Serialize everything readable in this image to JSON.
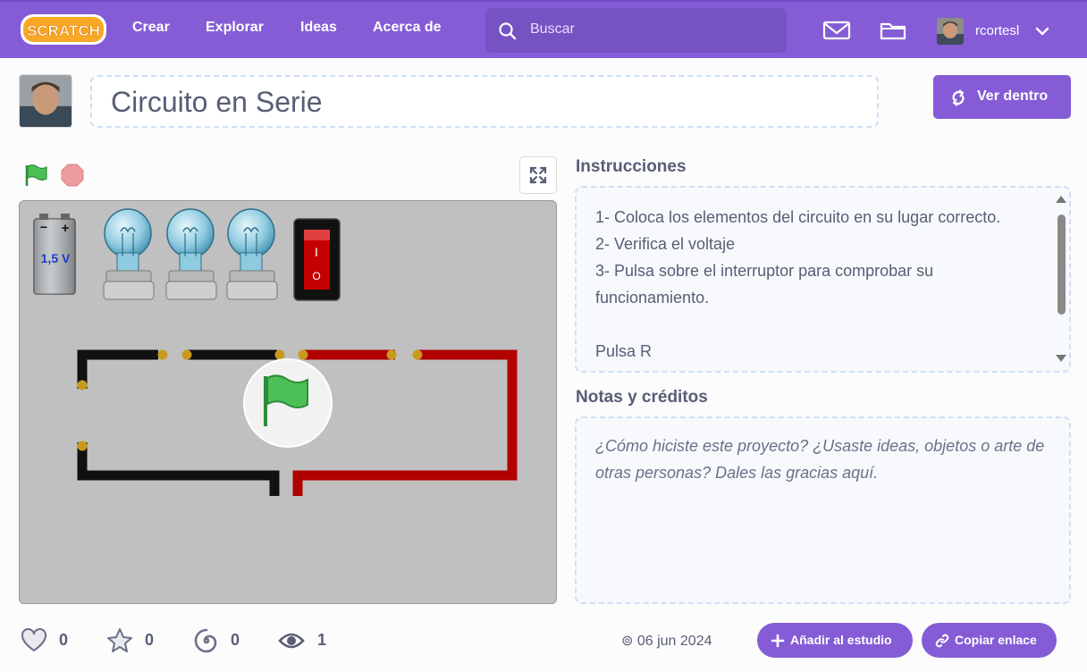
{
  "nav": {
    "logo_text": "SCRATCH",
    "links": [
      "Crear",
      "Explorar",
      "Ideas",
      "Acerca de"
    ],
    "search_placeholder": "Buscar",
    "username": "rcortesl"
  },
  "project": {
    "title": "Circuito en Serie",
    "see_inside_label": "Ver dentro"
  },
  "stage": {
    "battery_label": "1,5 V",
    "battery_minus": "−",
    "battery_plus": "+",
    "switch_on": "I",
    "switch_off": "O"
  },
  "instructions": {
    "heading": "Instrucciones",
    "text": "1- Coloca los elementos del circuito en su lugar correcto.\n2- Verifica el voltaje\n3- Pulsa sobre el interruptor para comprobar su funcionamiento.\n\nPulsa R"
  },
  "notes": {
    "heading": "Notas y créditos",
    "placeholder": "¿Cómo hiciste este proyecto? ¿Usaste ideas, objetos o arte de otras personas? Dales las gracias aquí."
  },
  "stats": {
    "loves": "0",
    "favorites": "0",
    "remixes": "0",
    "views": "1"
  },
  "footer": {
    "date": "06 jun 2024",
    "add_studio_label": "Añadir al estudio",
    "copy_link_label": "Copiar enlace"
  },
  "colors": {
    "brand": "#855cd6",
    "wire_black": "#111111",
    "wire_red": "#b00000",
    "flag_green": "#4cbf56"
  },
  "icons": [
    "search-icon",
    "mail-icon",
    "folder-icon",
    "chevron-down-icon",
    "remix-icon",
    "green-flag-icon",
    "stop-icon",
    "fullscreen-icon",
    "heart-icon",
    "star-icon",
    "spiral-icon",
    "eye-icon",
    "plus-icon",
    "link-icon"
  ]
}
